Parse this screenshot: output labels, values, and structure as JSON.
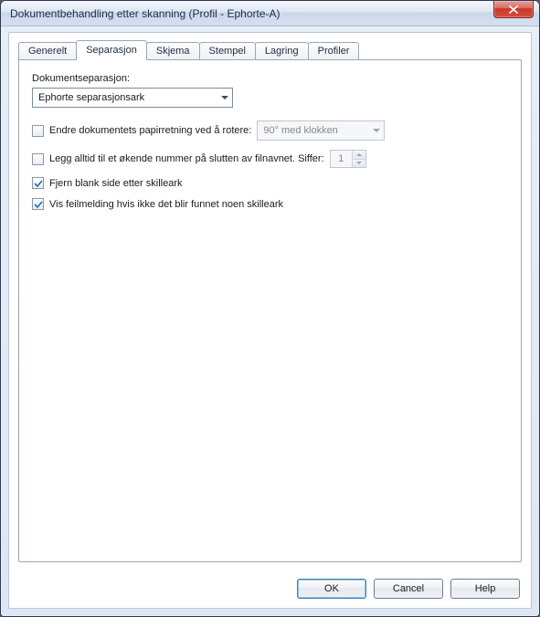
{
  "window": {
    "title": "Dokumentbehandling etter skanning (Profil - Ephorte-A)"
  },
  "tabs": [
    {
      "label": "Generelt"
    },
    {
      "label": "Separasjon"
    },
    {
      "label": "Skjema"
    },
    {
      "label": "Stempel"
    },
    {
      "label": "Lagring"
    },
    {
      "label": "Profiler"
    }
  ],
  "active_tab_index": 1,
  "separation": {
    "section_label": "Dokumentseparasjon:",
    "method_value": "Ephorte separasjonsark",
    "rotate": {
      "checked": false,
      "label": "Endre dokumentets papirretning ved å rotere:",
      "value": "90° med klokken"
    },
    "number_suffix": {
      "checked": false,
      "label": "Legg alltid til et økende nummer på slutten av filnavnet. Siffer:",
      "digits": "1"
    },
    "remove_blank": {
      "checked": true,
      "label": "Fjern blank side etter skilleark"
    },
    "show_error": {
      "checked": true,
      "label": "Vis feilmelding hvis ikke det blir funnet noen skilleark"
    }
  },
  "buttons": {
    "ok": "OK",
    "cancel": "Cancel",
    "help": "Help"
  }
}
